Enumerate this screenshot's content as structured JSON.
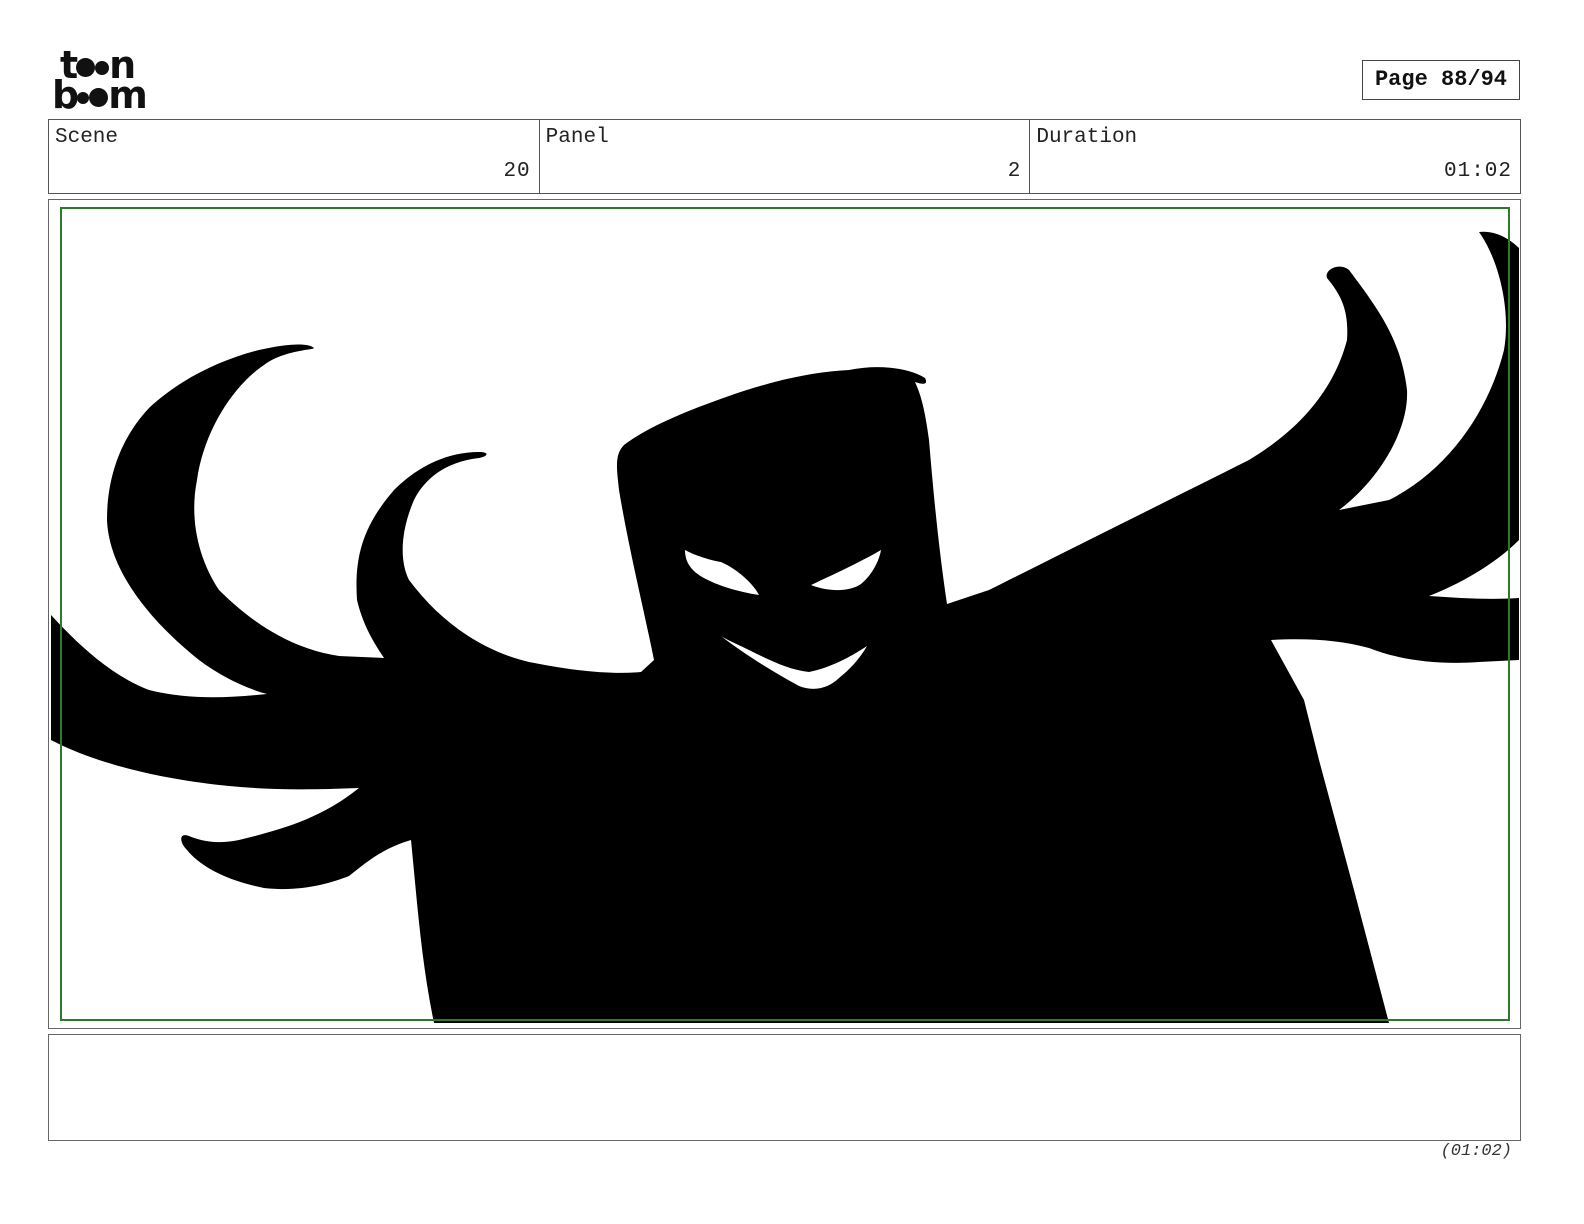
{
  "brand": {
    "logo_line1": "toon",
    "logo_line2": "boom"
  },
  "page_label": "Page 88/94",
  "panel_info": {
    "scene_label": "Scene",
    "scene_value": "20",
    "panel_label": "Panel",
    "panel_value": "2",
    "duration_label": "Duration",
    "duration_value": "01:02"
  },
  "artwork": {
    "description_icon": "silhouette-creature-drawing"
  },
  "notes": {
    "text": ""
  },
  "footer": {
    "duration_total": "(01:02)"
  },
  "colors": {
    "safe_frame": "#2c7a2c",
    "silhouette": "#000000"
  }
}
